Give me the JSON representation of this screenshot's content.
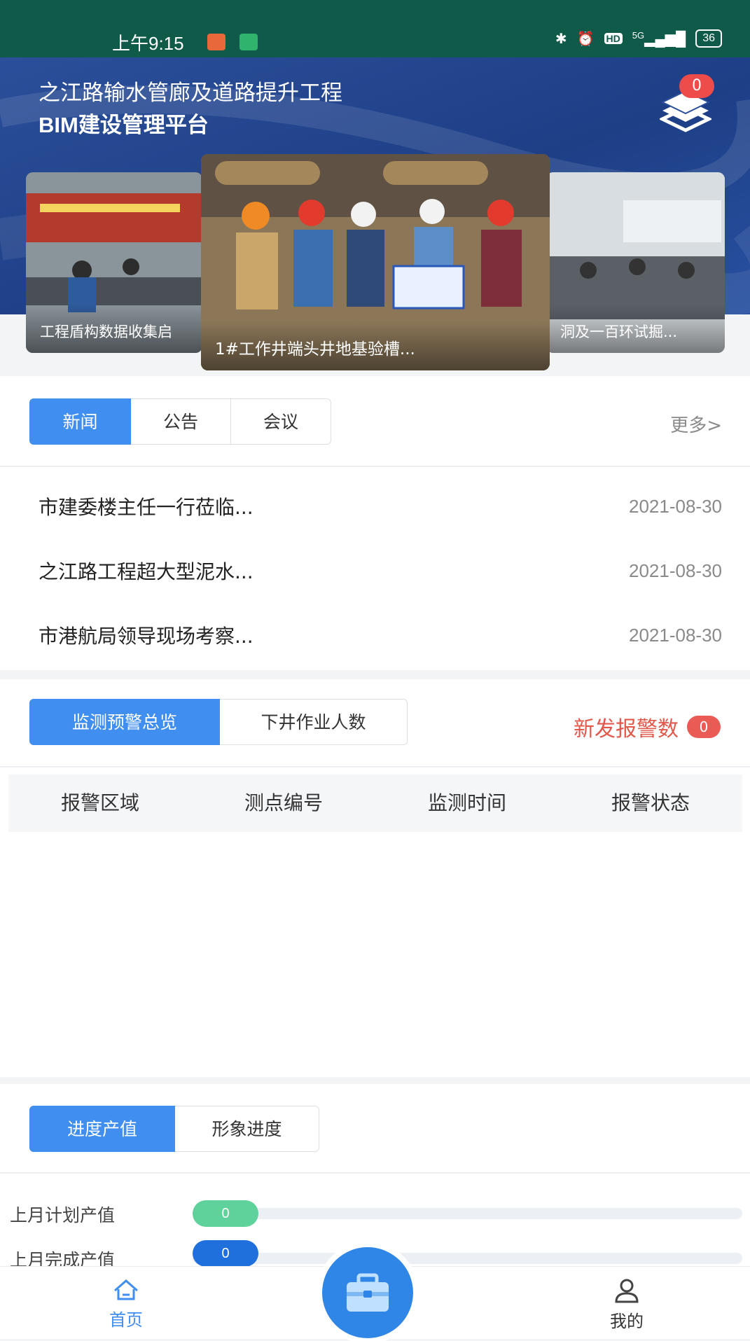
{
  "statusbar": {
    "time": "上午9:15",
    "network": "5G",
    "battery": "36",
    "hd": "HD"
  },
  "header": {
    "title_line1": "之江路输水管廊及道路提升工程",
    "title_line2": "BIM建设管理平台",
    "notification_count": "0"
  },
  "carousel": [
    {
      "caption": "工程盾构数据收集启"
    },
    {
      "caption": "1#工作井端头井地基验槽..."
    },
    {
      "caption": "洞及一百环试掘..."
    }
  ],
  "news": {
    "tabs": [
      "新闻",
      "公告",
      "会议"
    ],
    "active_tab": "新闻",
    "more_label": "更多>",
    "items": [
      {
        "title": "市建委楼主任一行莅临...",
        "date": "2021-08-30"
      },
      {
        "title": "之江路工程超大型泥水...",
        "date": "2021-08-30"
      },
      {
        "title": "市港航局领导现场考察...",
        "date": "2021-08-30"
      }
    ]
  },
  "monitor": {
    "tabs": [
      "监测预警总览",
      "下井作业人数"
    ],
    "active_tab": "监测预警总览",
    "alarm_label": "新发报警数",
    "alarm_count": "0",
    "columns": [
      "报警区域",
      "测点编号",
      "监测时间",
      "报警状态"
    ]
  },
  "progress": {
    "tabs": [
      "进度产值",
      "形象进度"
    ],
    "active_tab": "进度产值",
    "rows": [
      {
        "label": "上月计划产值",
        "value": "0",
        "color": "#5fd19a"
      },
      {
        "label": "上月完成产值",
        "value": "0",
        "color": "#1f6fdc"
      }
    ]
  },
  "tabbar": {
    "home_label": "首页",
    "mine_label": "我的"
  },
  "colors": {
    "accent": "#3f8ef0",
    "statusbar": "#0f5a49",
    "alarm": "#e2594b"
  }
}
